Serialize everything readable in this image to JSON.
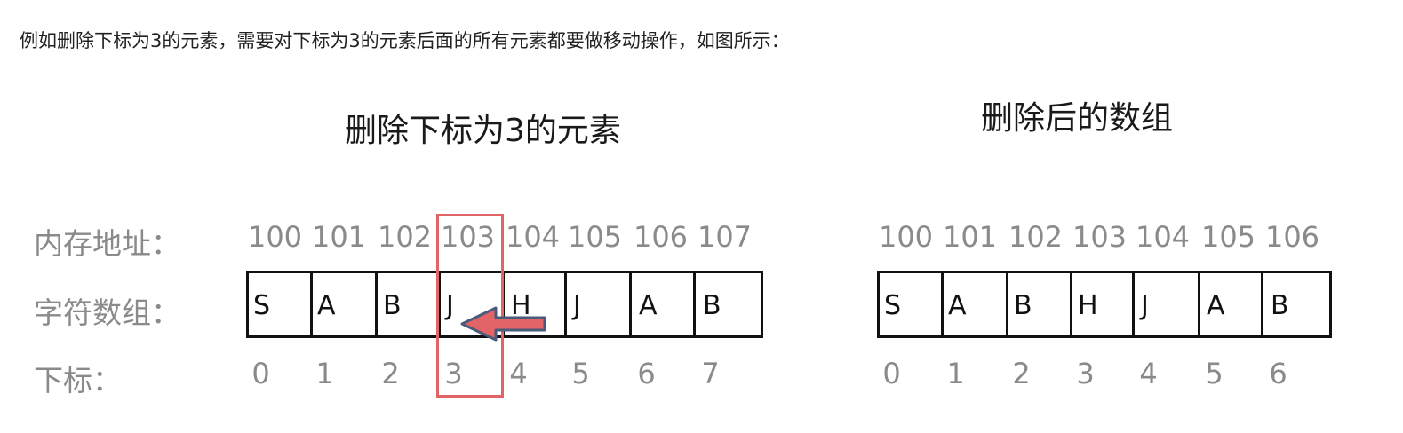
{
  "intro_text": "例如删除下标为3的元素，需要对下标为3的元素后面的所有元素都要做移动操作，如图所示：",
  "left_diagram": {
    "title": "删除下标为3的元素",
    "labels": {
      "address": "内存地址：",
      "chars": "字符数组：",
      "index": "下标："
    },
    "addresses": [
      "100",
      "101",
      "102",
      "103",
      "104",
      "105",
      "106",
      "107"
    ],
    "chars": [
      "S",
      "A",
      "B",
      "J",
      "H",
      "J",
      "A",
      "B"
    ],
    "indices": [
      "0",
      "1",
      "2",
      "3",
      "4",
      "5",
      "6",
      "7"
    ],
    "deleted_index": 3
  },
  "right_diagram": {
    "title": "删除后的数组",
    "addresses": [
      "100",
      "101",
      "102",
      "103",
      "104",
      "105",
      "106"
    ],
    "chars": [
      "S",
      "A",
      "B",
      "H",
      "J",
      "A",
      "B"
    ],
    "indices": [
      "0",
      "1",
      "2",
      "3",
      "4",
      "5",
      "6"
    ]
  },
  "colors": {
    "highlight": "#e36467",
    "arrow_fill": "#e36467",
    "arrow_stroke": "#4a5a7a",
    "label": "#8a8a8a"
  }
}
